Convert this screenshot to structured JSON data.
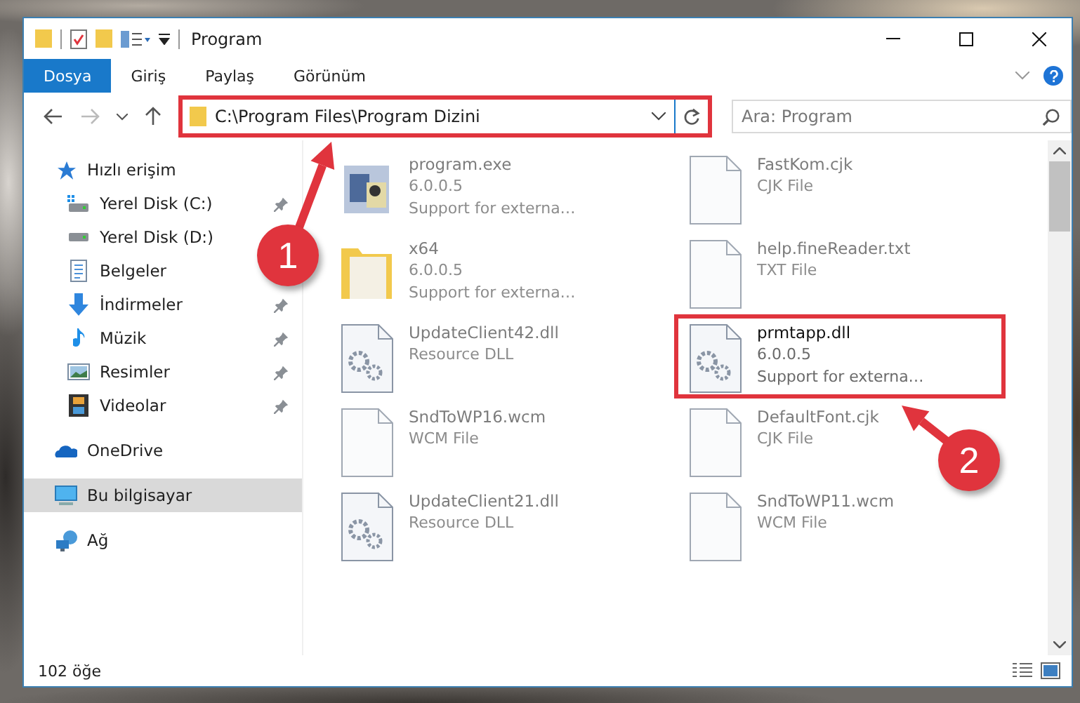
{
  "window": {
    "title": "Program"
  },
  "ribbon_tabs": [
    {
      "label": "Dosya",
      "selected": true
    },
    {
      "label": "Giriş",
      "selected": false
    },
    {
      "label": "Paylaş",
      "selected": false
    },
    {
      "label": "Görünüm",
      "selected": false
    }
  ],
  "address_bar": {
    "path": "C:\\Program Files\\Program Dizini",
    "highlighted": true
  },
  "search": {
    "placeholder": "Ara: Program"
  },
  "nav_pane": {
    "items": [
      {
        "label": "Hızlı erişim",
        "kind": "star",
        "selected": false,
        "children": [
          {
            "label": "Yerel Disk (C:)",
            "kind": "drive-c",
            "pinned": true,
            "selected": false
          },
          {
            "label": "Yerel Disk (D:)",
            "kind": "drive",
            "pinned": false,
            "selected": false
          },
          {
            "label": "Belgeler",
            "kind": "docs",
            "pinned": false,
            "selected": false
          },
          {
            "label": "İndirmeler",
            "kind": "download",
            "pinned": true,
            "selected": false
          },
          {
            "label": "Müzik",
            "kind": "music",
            "pinned": true,
            "selected": false
          },
          {
            "label": "Resimler",
            "kind": "pictures",
            "pinned": true,
            "selected": false
          },
          {
            "label": "Videolar",
            "kind": "videos",
            "pinned": true,
            "selected": false
          }
        ]
      },
      {
        "label": "OneDrive",
        "kind": "cloud",
        "selected": false
      },
      {
        "label": "Bu bilgisayar",
        "kind": "pc",
        "selected": true
      },
      {
        "label": "Ağ",
        "kind": "network",
        "selected": false
      }
    ]
  },
  "files": [
    {
      "name": "program.exe",
      "details": [
        "6.0.0.5",
        "Support for externa…"
      ],
      "kind": "exe",
      "blurred": true,
      "highlighted": false
    },
    {
      "name": "FastKom.cjk",
      "details": [
        "CJK File"
      ],
      "kind": "file",
      "blurred": true,
      "highlighted": false
    },
    {
      "name": "x64",
      "details": [
        "6.0.0.5",
        "Support for externa…"
      ],
      "kind": "folder",
      "blurred": true,
      "highlighted": false
    },
    {
      "name": "help.fineReader.txt",
      "details": [
        "TXT File"
      ],
      "kind": "file",
      "blurred": true,
      "highlighted": false
    },
    {
      "name": "UpdateClient42.dll",
      "details": [
        "Resource DLL"
      ],
      "kind": "dll",
      "blurred": true,
      "highlighted": false
    },
    {
      "name": "prmtapp.dll",
      "details": [
        "6.0.0.5",
        "Support for externa…"
      ],
      "kind": "dll",
      "blurred": false,
      "highlighted": true
    },
    {
      "name": "SndToWP16.wcm",
      "details": [
        "WCM File"
      ],
      "kind": "file",
      "blurred": true,
      "highlighted": false
    },
    {
      "name": "DefaultFont.cjk",
      "details": [
        "CJK File"
      ],
      "kind": "file",
      "blurred": true,
      "highlighted": false
    },
    {
      "name": "UpdateClient21.dll",
      "details": [
        "Resource DLL"
      ],
      "kind": "dll",
      "blurred": true,
      "highlighted": false
    },
    {
      "name": "SndToWP11.wcm",
      "details": [
        "WCM File"
      ],
      "kind": "file",
      "blurred": true,
      "highlighted": false
    }
  ],
  "status_bar": {
    "item_count": "102 öğe"
  },
  "callouts": [
    {
      "number": "1"
    },
    {
      "number": "2"
    }
  ]
}
